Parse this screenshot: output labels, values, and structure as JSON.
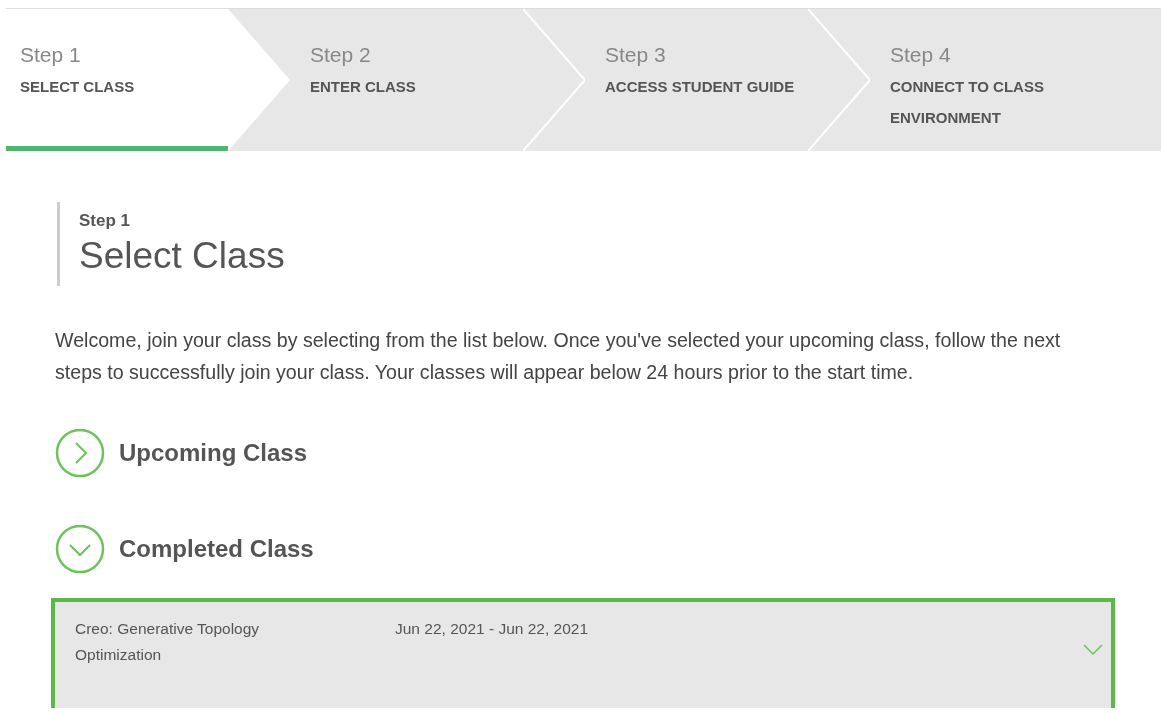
{
  "steps": [
    {
      "label": "Step 1",
      "title": "SELECT CLASS",
      "selected": true
    },
    {
      "label": "Step 2",
      "title": "ENTER CLASS",
      "selected": false
    },
    {
      "label": "Step 3",
      "title": "ACCESS STUDENT GUIDE",
      "selected": false
    },
    {
      "label": "Step 4",
      "title": "CONNECT TO CLASS ENVIRONMENT",
      "selected": false
    }
  ],
  "heading": {
    "step": "Step 1",
    "title": "Select Class"
  },
  "intro": "Welcome, join your class by selecting from the list below. Once you've selected your upcoming class, follow the next steps to successfully join your class. Your classes will appear below 24 hours prior to the start time.",
  "sections": [
    {
      "title": "Upcoming Class",
      "expanded": false
    },
    {
      "title": "Completed Class",
      "expanded": true
    }
  ],
  "classes": [
    {
      "name": "Creo: Generative Topology Optimization",
      "dates": "Jun 22, 2021 - Jun 22, 2021",
      "selected": true
    }
  ]
}
